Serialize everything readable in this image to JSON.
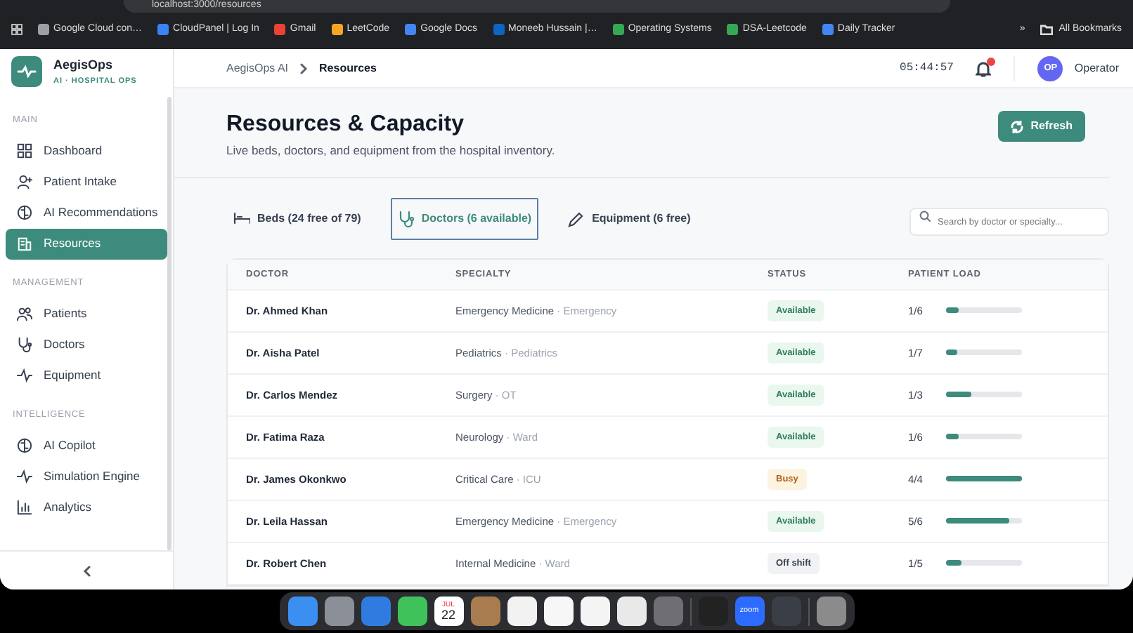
{
  "browser": {
    "url": "localhost:3000/resources",
    "bookmarks": [
      "Google Cloud con…",
      "CloudPanel | Log In",
      "Gmail",
      "LeetCode",
      "Google Docs",
      "Moneeb Hussain |…",
      "Operating Systems",
      "DSA-Leetcode",
      "Daily Tracker"
    ],
    "more": "»",
    "all_bookmarks": "All Bookmarks"
  },
  "sidebar": {
    "brand": "AegisOps",
    "tagline": "AI · HOSPITAL OPS",
    "sections": [
      {
        "title": "MAIN",
        "items": [
          {
            "label": "Dashboard",
            "selected": false
          },
          {
            "label": "Patient Intake",
            "selected": false
          },
          {
            "label": "AI Recommendations",
            "selected": false
          },
          {
            "label": "Resources",
            "selected": true
          }
        ]
      },
      {
        "title": "MANAGEMENT",
        "items": [
          {
            "label": "Patients",
            "selected": false
          },
          {
            "label": "Doctors",
            "selected": false
          },
          {
            "label": "Equipment",
            "selected": false
          }
        ]
      },
      {
        "title": "INTELLIGENCE",
        "items": [
          {
            "label": "AI Copilot",
            "selected": false
          },
          {
            "label": "Simulation Engine",
            "selected": false
          },
          {
            "label": "Analytics",
            "selected": false
          }
        ]
      }
    ]
  },
  "header": {
    "breadcrumb": [
      "AegisOps AI",
      "Resources"
    ],
    "clock": "05:44:57",
    "notification_unread": true,
    "user_initials": "OP",
    "user_name": "Operator"
  },
  "page": {
    "title": "Resources & Capacity",
    "subtitle": "Live beds, doctors, and equipment from the hospital inventory.",
    "refresh": "Refresh"
  },
  "tabs": [
    {
      "label": "Beds (24 free of 79)",
      "selected": false
    },
    {
      "label": "Doctors (6 available)",
      "selected": true
    },
    {
      "label": "Equipment (6 free)",
      "selected": false
    }
  ],
  "search": {
    "placeholder": "Search by doctor or specialty..."
  },
  "table": {
    "columns": [
      "DOCTOR",
      "SPECIALTY",
      "STATUS",
      "PATIENT LOAD"
    ],
    "rows": [
      {
        "doctor": "Dr. Ahmed Khan",
        "specialty": "Emergency Medicine",
        "location": "· Emergency",
        "status": {
          "label": "Available",
          "kind": "available"
        },
        "load": "1/6",
        "level": 0.17
      },
      {
        "doctor": "Dr. Aisha Patel",
        "specialty": "Pediatrics",
        "location": "· Pediatrics",
        "status": {
          "label": "Available",
          "kind": "available"
        },
        "load": "1/7",
        "level": 0.14
      },
      {
        "doctor": "Dr. Carlos Mendez",
        "specialty": "Surgery",
        "location": "· OT",
        "status": {
          "label": "Available",
          "kind": "available"
        },
        "load": "1/3",
        "level": 0.33
      },
      {
        "doctor": "Dr. Fatima Raza",
        "specialty": "Neurology",
        "location": "· Ward",
        "status": {
          "label": "Available",
          "kind": "available"
        },
        "load": "1/6",
        "level": 0.17
      },
      {
        "doctor": "Dr. James Okonkwo",
        "specialty": "Critical Care",
        "location": "· ICU",
        "status": {
          "label": "Busy",
          "kind": "busy"
        },
        "load": "4/4",
        "level": 1
      },
      {
        "doctor": "Dr. Leila Hassan",
        "specialty": "Emergency Medicine",
        "location": "· Emergency",
        "status": {
          "label": "Available",
          "kind": "available"
        },
        "load": "5/6",
        "level": 0.83
      },
      {
        "doctor": "Dr. Robert Chen",
        "specialty": "Internal Medicine",
        "location": "· Ward",
        "status": {
          "label": "Off shift",
          "kind": "off"
        },
        "load": "1/5",
        "level": 0.2
      }
    ]
  },
  "dock": [
    {
      "kind": "app"
    },
    {
      "kind": "app"
    },
    {
      "kind": "app"
    },
    {
      "kind": "app"
    },
    {
      "kind": "calendar",
      "month": "JUL",
      "day": "22"
    },
    {
      "kind": "app"
    },
    {
      "kind": "app"
    },
    {
      "kind": "app"
    },
    {
      "kind": "app"
    },
    {
      "kind": "app"
    },
    {
      "kind": "app"
    },
    {
      "kind": "separator"
    },
    {
      "kind": "app"
    },
    {
      "kind": "labeled",
      "label": "zoom"
    },
    {
      "kind": "app"
    },
    {
      "kind": "separator"
    },
    {
      "kind": "app"
    }
  ]
}
